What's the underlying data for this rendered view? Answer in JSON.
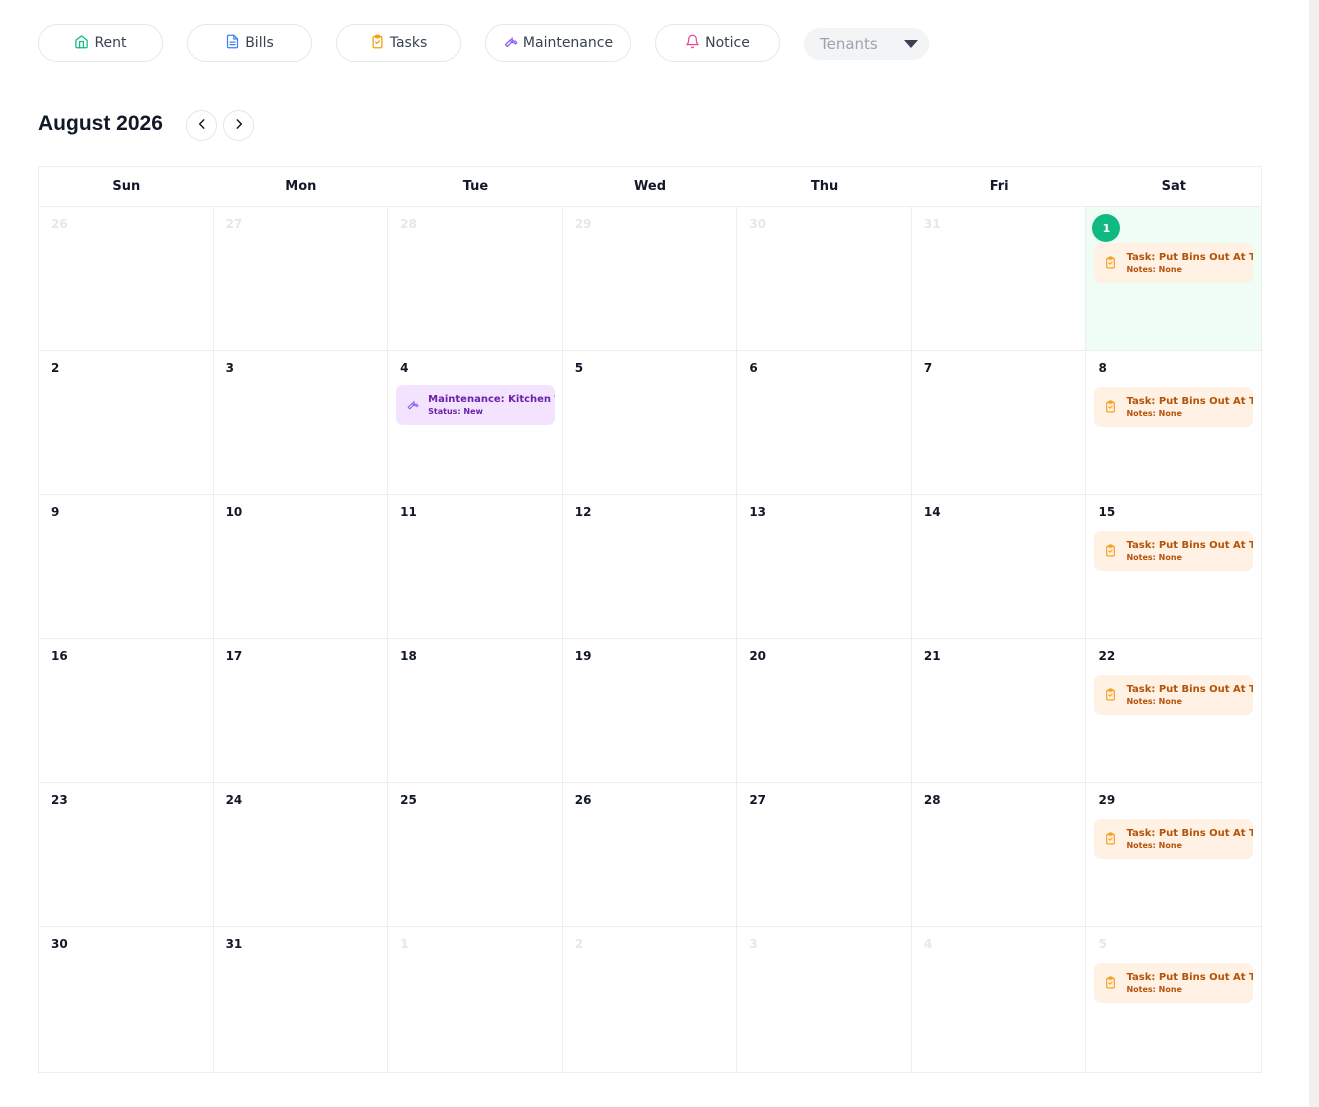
{
  "filters": {
    "rent": "Rent",
    "bills": "Bills",
    "tasks": "Tasks",
    "maintenance": "Maintenance",
    "notice": "Notice",
    "tenants": "Tenants"
  },
  "colors": {
    "rent": "#10b981",
    "bills": "#3b82f6",
    "tasks": "#f59e0b",
    "maintenance": "#8b5cf6",
    "notice": "#ec4899",
    "today": "#10b981"
  },
  "calendar": {
    "month_title": "August 2026",
    "weekdays": [
      "Sun",
      "Mon",
      "Tue",
      "Wed",
      "Thu",
      "Fri",
      "Sat"
    ],
    "weeks": [
      [
        {
          "n": "26",
          "muted": true
        },
        {
          "n": "27",
          "muted": true
        },
        {
          "n": "28",
          "muted": true
        },
        {
          "n": "29",
          "muted": true
        },
        {
          "n": "30",
          "muted": true
        },
        {
          "n": "31",
          "muted": true
        },
        {
          "n": "1",
          "today": true
        }
      ],
      [
        {
          "n": "2"
        },
        {
          "n": "3"
        },
        {
          "n": "4"
        },
        {
          "n": "5"
        },
        {
          "n": "6"
        },
        {
          "n": "7"
        },
        {
          "n": "8"
        }
      ],
      [
        {
          "n": "9"
        },
        {
          "n": "10"
        },
        {
          "n": "11"
        },
        {
          "n": "12"
        },
        {
          "n": "13"
        },
        {
          "n": "14"
        },
        {
          "n": "15"
        }
      ],
      [
        {
          "n": "16"
        },
        {
          "n": "17"
        },
        {
          "n": "18"
        },
        {
          "n": "19"
        },
        {
          "n": "20"
        },
        {
          "n": "21"
        },
        {
          "n": "22"
        }
      ],
      [
        {
          "n": "23"
        },
        {
          "n": "24"
        },
        {
          "n": "25"
        },
        {
          "n": "26"
        },
        {
          "n": "27"
        },
        {
          "n": "28"
        },
        {
          "n": "29"
        }
      ],
      [
        {
          "n": "30"
        },
        {
          "n": "31"
        },
        {
          "n": "1",
          "muted": true
        },
        {
          "n": "2",
          "muted": true
        },
        {
          "n": "3",
          "muted": true
        },
        {
          "n": "4",
          "muted": true
        },
        {
          "n": "5",
          "muted": true
        }
      ]
    ]
  },
  "events": {
    "task_title": "Task: Put Bins Out At Tap",
    "task_sub": "Notes: None",
    "maint_title": "Maintenance: Kitchen Tap",
    "maint_sub": "Status: New"
  }
}
